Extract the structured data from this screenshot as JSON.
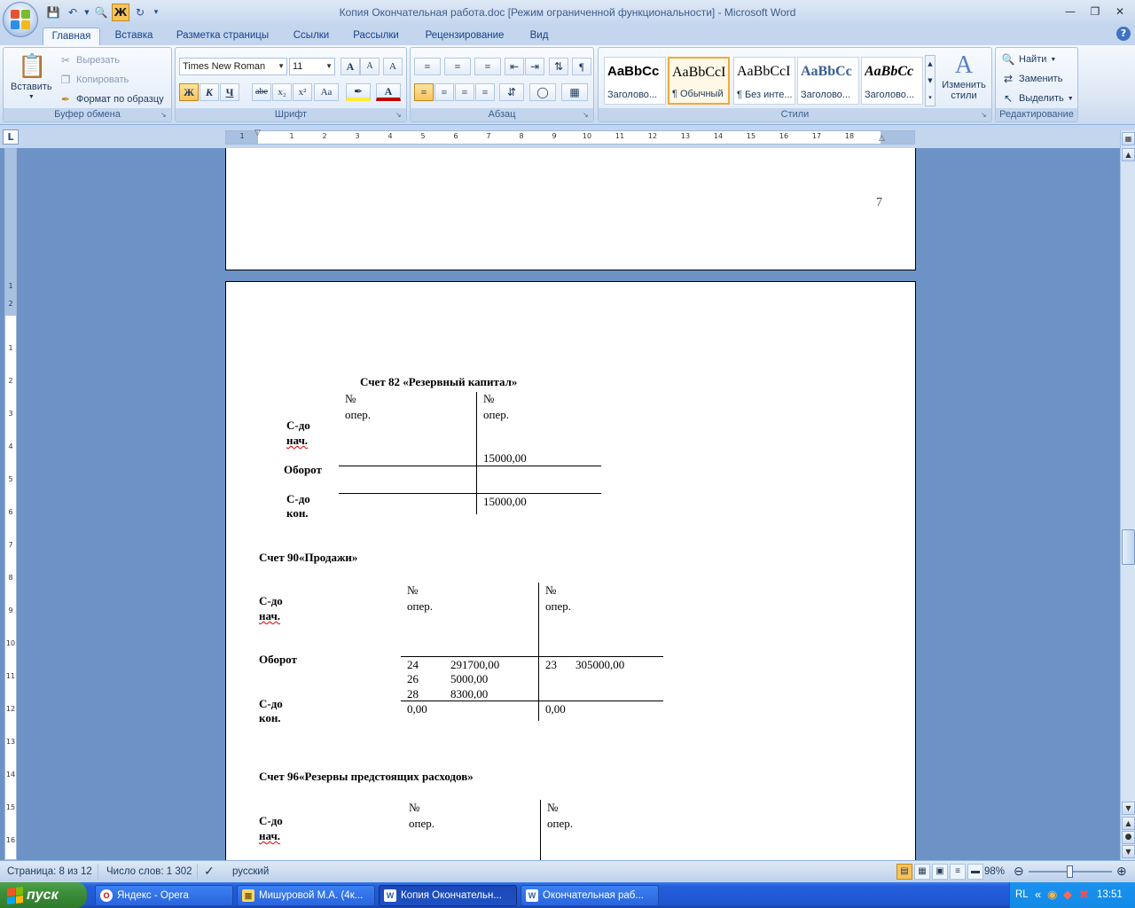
{
  "window": {
    "title": "Копия Окончательная работа.doc [Режим ограниченной функциональности] - Microsoft Word"
  },
  "tabs": [
    "Главная",
    "Вставка",
    "Разметка страницы",
    "Ссылки",
    "Рассылки",
    "Рецензирование",
    "Вид"
  ],
  "ribbon": {
    "clipboard": {
      "paste": "Вставить",
      "cut": "Вырезать",
      "copy": "Копировать",
      "format_painter": "Формат по образцу",
      "label": "Буфер обмена"
    },
    "font": {
      "name": "Times New Roman",
      "size": "11",
      "bold": "Ж",
      "italic": "К",
      "underline": "Ч",
      "strike": "abe",
      "subscript": "x₂",
      "superscript": "x²",
      "change_case": "Aa",
      "grow": "A",
      "shrink": "A",
      "clear": "A",
      "color": "A",
      "label": "Шрифт"
    },
    "paragraph": {
      "label": "Абзац"
    },
    "styles": {
      "items": [
        {
          "preview": "AaBbCc",
          "name": "Заголово..."
        },
        {
          "preview": "AaBbCcI",
          "name": "¶ Обычный"
        },
        {
          "preview": "AaBbCcI",
          "name": "¶ Без инте..."
        },
        {
          "preview": "AaBbCc",
          "name": "Заголово..."
        },
        {
          "preview": "AaBbCc",
          "name": "Заголово..."
        }
      ],
      "change_styles": "Изменить стили",
      "label": "Стили"
    },
    "editing": {
      "find": "Найти",
      "replace": "Заменить",
      "select": "Выделить",
      "label": "Редактирование"
    }
  },
  "ruler": {
    "h_ticks": [
      "1",
      "1",
      "2",
      "3",
      "4",
      "5",
      "6",
      "7",
      "8",
      "9",
      "10",
      "11",
      "12",
      "13",
      "14",
      "15",
      "16",
      "17",
      "18"
    ],
    "v_ticks": [
      "1",
      "2",
      "1",
      "2",
      "3",
      "4",
      "5",
      "6",
      "7",
      "8",
      "9",
      "10",
      "11",
      "12",
      "13",
      "14",
      "15",
      "16"
    ]
  },
  "document": {
    "page_number": "7",
    "account82": {
      "title": "Счет 82 «Резервный капитал»",
      "no": "№",
      "oper": "опер.",
      "sdo_nach_1": "С-до",
      "sdo_nach_2": "нач.",
      "oborot": "Оборот",
      "sdo_kon_1": "С-до",
      "sdo_kon_2": "кон.",
      "credit_begin": "15000,00",
      "credit_end": "15000,00"
    },
    "account90": {
      "title": "Счет 90«Продажи»",
      "no": "№",
      "oper": "опер.",
      "sdo_nach_1": "С-до",
      "sdo_nach_2": "нач.",
      "oborot": "Оборот",
      "sdo_kon_1": "С-до",
      "sdo_kon_2": "кон.",
      "debit_rows": [
        {
          "op": "24",
          "amount": "291700,00"
        },
        {
          "op": "26",
          "amount": "5000,00"
        },
        {
          "op": "28",
          "amount": "8300,00"
        }
      ],
      "credit_rows": [
        {
          "op": "23",
          "amount": "305000,00"
        }
      ],
      "debit_end": "0,00",
      "credit_end": "0,00"
    },
    "account96": {
      "title": "Счет 96«Резервы предстоящих расходов»",
      "no": "№",
      "oper": "опер.",
      "sdo_nach_1": "С-до",
      "sdo_nach_2": "нач."
    }
  },
  "status": {
    "page": "Страница: 8 из 12",
    "words": "Число слов: 1 302",
    "language": "русский",
    "zoom": "98%"
  },
  "taskbar": {
    "start": "пуск",
    "tasks": [
      "Яндекс - Opera",
      "Мишуровой М.А. (4к...",
      "Копия Окончательн...",
      "Окончательная раб..."
    ],
    "lang": "RL",
    "time": "13:51"
  }
}
